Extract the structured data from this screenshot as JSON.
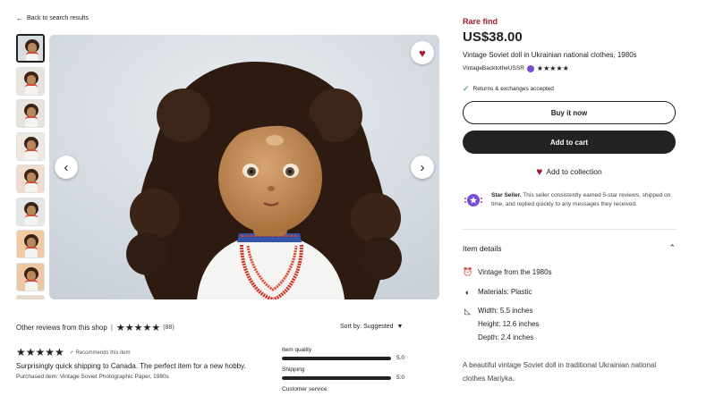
{
  "nav": {
    "back_label": "Back to search results"
  },
  "gallery": {
    "thumb_count": 9,
    "active_index": 0
  },
  "product": {
    "badge": "Rare find",
    "price": "US$38.00",
    "title": "Vintage Soviet doll in Ukrainian national clothes, 1980s",
    "shop_name": "VintageBacktotheUSSR",
    "shop_stars": "★★★★★",
    "returns": "Returns & exchanges accepted",
    "buy_now": "Buy it now",
    "add_to_cart": "Add to cart",
    "add_to_collection": "Add to collection"
  },
  "star_seller": {
    "title": "Star Seller.",
    "text": " This seller consistently earned 5-star reviews, shipped on time, and replied quickly to any messages they received."
  },
  "item_details": {
    "heading": "Item details",
    "origin": "Vintage from the 1980s",
    "materials": "Materials: Plastic",
    "width": "Width: 5.5 inches",
    "height": "Height: 12.6 inches",
    "depth": "Depth: 2.4 inches",
    "description": "A beautiful vintage Soviet doll in traditional Ukrainian national clothes Mariyka."
  },
  "reviews": {
    "heading": "Other reviews from this shop",
    "stars": "★★★★★",
    "count": "(88)",
    "sort_label": "Sort by: Suggested",
    "first": {
      "stars": "★★★★★",
      "recommends": "Recommends this item",
      "text": "Surprisingly quick shipping to Canada. The perfect item for a new hobby.",
      "purchased": "Purchased item: Vintage Soviet Photographic Paper, 1980s"
    },
    "ratings": [
      {
        "label": "Item quality",
        "value": "5.0",
        "fraction": 1.0
      },
      {
        "label": "Shipping",
        "value": "5.0",
        "fraction": 1.0
      },
      {
        "label": "Customer service",
        "value": "",
        "fraction": 1.0
      }
    ]
  },
  "colors": {
    "accent_red": "#a61a2e",
    "dark": "#222222",
    "star_seller_purple": "#7b4bd6"
  }
}
